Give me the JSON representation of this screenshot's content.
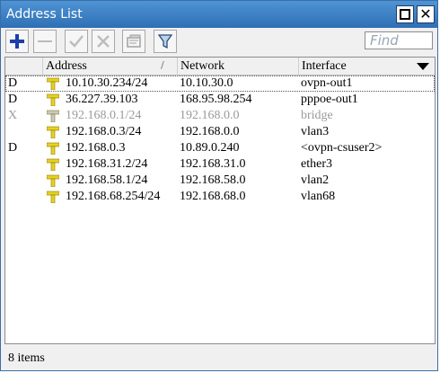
{
  "window": {
    "title": "Address List"
  },
  "toolbar": {
    "find_placeholder": "Find"
  },
  "columns": [
    {
      "label": ""
    },
    {
      "label": "Address",
      "sort_indicator": "/"
    },
    {
      "label": "Network"
    },
    {
      "label": "Interface"
    }
  ],
  "rows": [
    {
      "flag": "D",
      "address": "10.10.30.234/24",
      "network": "10.10.30.0",
      "interface": "ovpn-out1",
      "disabled": false,
      "selected": true
    },
    {
      "flag": "D",
      "address": "36.227.39.103",
      "network": "168.95.98.254",
      "interface": "pppoe-out1",
      "disabled": false,
      "selected": false
    },
    {
      "flag": "X",
      "address": "192.168.0.1/24",
      "network": "192.168.0.0",
      "interface": "bridge",
      "disabled": true,
      "selected": false
    },
    {
      "flag": "",
      "address": "192.168.0.3/24",
      "network": "192.168.0.0",
      "interface": "vlan3",
      "disabled": false,
      "selected": false
    },
    {
      "flag": "D",
      "address": "192.168.0.3",
      "network": "10.89.0.240",
      "interface": "<ovpn-csuser2>",
      "disabled": false,
      "selected": false
    },
    {
      "flag": "",
      "address": "192.168.31.2/24",
      "network": "192.168.31.0",
      "interface": "ether3",
      "disabled": false,
      "selected": false
    },
    {
      "flag": "",
      "address": "192.168.58.1/24",
      "network": "192.168.58.0",
      "interface": "vlan2",
      "disabled": false,
      "selected": false
    },
    {
      "flag": "",
      "address": "192.168.68.254/24",
      "network": "192.168.68.0",
      "interface": "vlan68",
      "disabled": false,
      "selected": false
    }
  ],
  "status": {
    "item_count": "8 items"
  },
  "colors": {
    "titlebar": "#3b80c6",
    "add_icon": "#1d3fa8",
    "address_icon": "#e7d21a",
    "disabled_text": "#9a9a9a"
  }
}
